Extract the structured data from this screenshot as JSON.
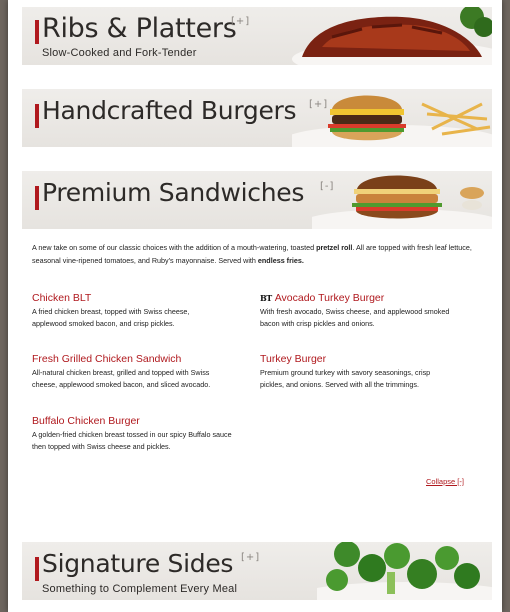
{
  "sections": {
    "ribs": {
      "title": "Ribs & Platters",
      "toggle": "[+]",
      "subtitle": "Slow-Cooked and Fork-Tender"
    },
    "burgers": {
      "title": "Handcrafted Burgers",
      "toggle": "[+]"
    },
    "sandwiches": {
      "title": "Premium Sandwiches",
      "toggle": "[-]"
    },
    "sides": {
      "title": "Signature Sides",
      "toggle": "[+]",
      "subtitle": "Something to Complement Every Meal"
    }
  },
  "intro": {
    "part1": "A new take on some of our classic choices with the addition of a mouth-watering, toasted ",
    "bold1": "pretzel roll",
    "part2": ". All are topped with fresh leaf lettuce, seasonal vine-ripened tomatoes, and Ruby's mayonnaise. Served with ",
    "bold2": "endless fries."
  },
  "items": {
    "chicken_blt": {
      "name": "Chicken BLT",
      "desc": "A fried chicken breast, topped with Swiss cheese, applewood smoked bacon, and crisp pickles."
    },
    "avocado_turkey": {
      "badge": "BT",
      "name": "Avocado Turkey Burger",
      "desc": "With fresh avocado, Swiss cheese, and applewood smoked bacon with crisp pickles and onions."
    },
    "grilled_chicken": {
      "name": "Fresh Grilled Chicken Sandwich",
      "desc": "All-natural chicken breast, grilled and topped with Swiss cheese, applewood smoked bacon, and sliced avocado."
    },
    "turkey_burger": {
      "name": "Turkey Burger",
      "desc": "Premium ground turkey with savory seasonings, crisp pickles, and onions. Served with all the trimmings."
    },
    "buffalo_chicken": {
      "name": "Buffalo Chicken Burger",
      "desc": "A golden-fried chicken breast tossed in our spicy Buffalo sauce then topped with Swiss cheese and pickles."
    }
  },
  "collapse_label": "Collapse [-]",
  "colors": {
    "accent": "#b0191e",
    "band": "#ebe8e5",
    "frame": "#6e665f"
  }
}
